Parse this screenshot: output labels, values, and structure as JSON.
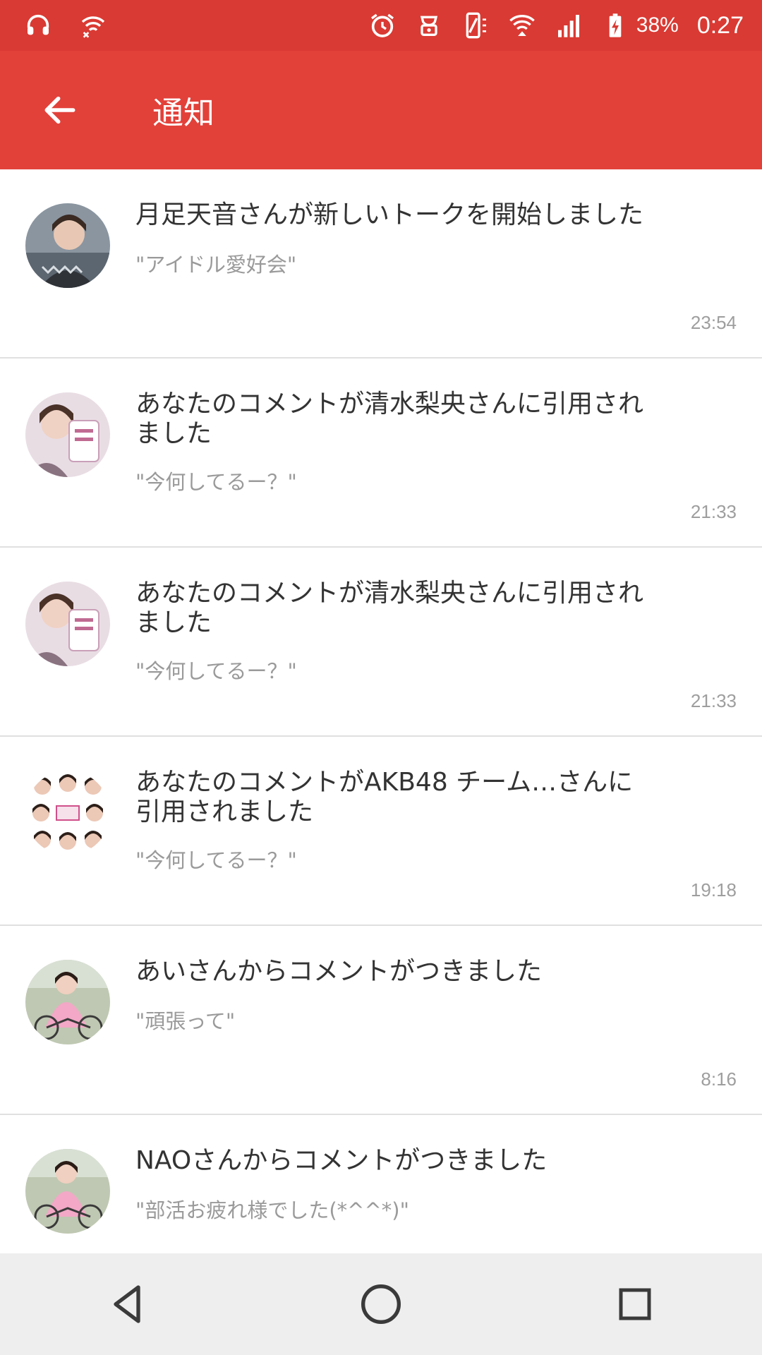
{
  "status_bar": {
    "battery_percent": "38%",
    "time": "0:27",
    "icons": [
      "headset-icon",
      "wifi-off-icon",
      "alarm-icon",
      "notification-icon",
      "vibrate-icon",
      "wifi-icon",
      "signal-icon",
      "battery-charging-icon"
    ]
  },
  "app_bar": {
    "title": "通知",
    "back_icon": "arrow-back-icon",
    "color": "#e2413a"
  },
  "notifications": [
    {
      "title": "月足天音さんが新しいトークを開始しました",
      "quote": "\"アイドル愛好会\"",
      "time": "23:54",
      "avatar": "avatar-1"
    },
    {
      "title": "あなたのコメントが清水梨央さんに引用されました",
      "quote": "\"今何してるー？\"",
      "time": "21:33",
      "avatar": "avatar-2"
    },
    {
      "title": "あなたのコメントが清水梨央さんに引用されました",
      "quote": "\"今何してるー？\"",
      "time": "21:33",
      "avatar": "avatar-2"
    },
    {
      "title": "あなたのコメントがAKB48 チーム…さんに引用されました",
      "quote": "\"今何してるー？\"",
      "time": "19:18",
      "avatar": "avatar-3"
    },
    {
      "title": "あいさんからコメントがつきました",
      "quote": "\"頑張って\"",
      "time": "8:16",
      "avatar": "avatar-4"
    },
    {
      "title": "NAOさんからコメントがつきました",
      "quote": "\"部活お疲れ様でした(*^^*)\"",
      "time": "",
      "avatar": "avatar-4"
    }
  ],
  "nav_bar": {
    "buttons": [
      "back-nav-icon",
      "home-nav-icon",
      "recents-nav-icon"
    ]
  }
}
